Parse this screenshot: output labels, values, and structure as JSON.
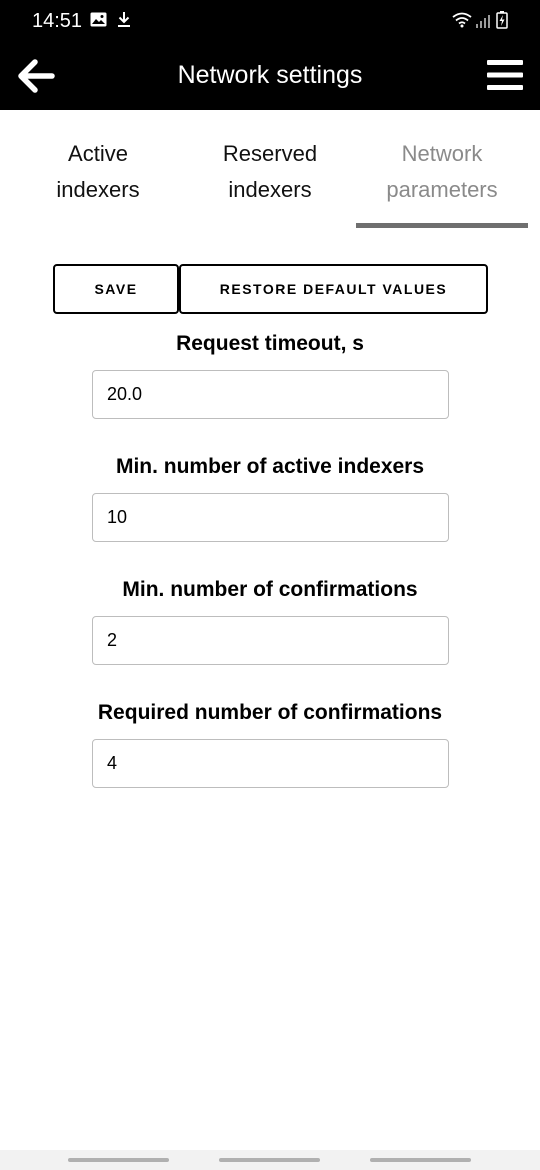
{
  "status_bar": {
    "time": "14:51",
    "icons": [
      "image-icon",
      "download-icon",
      "wifi-icon",
      "signal-icon",
      "battery-charging-icon"
    ]
  },
  "app_bar": {
    "title": "Network settings",
    "back_icon": "arrow-left-icon",
    "menu_icon": "hamburger-menu-icon"
  },
  "tabs": [
    {
      "line1": "Active",
      "line2": "indexers",
      "active": false
    },
    {
      "line1": "Reserved",
      "line2": "indexers",
      "active": false
    },
    {
      "line1": "Network",
      "line2": "parameters",
      "active": true
    }
  ],
  "actions": {
    "save_label": "SAVE",
    "restore_label": "RESTORE DEFAULT VALUES"
  },
  "fields": [
    {
      "label": "Request timeout, s",
      "value": "20.0"
    },
    {
      "label": "Min. number of active indexers",
      "value": "10"
    },
    {
      "label": "Min. number of confirmations",
      "value": "2"
    },
    {
      "label": "Required number of confirmations",
      "value": "4"
    }
  ],
  "colors": {
    "bar_background": "#000000",
    "active_tab_text": "#8a8a8a",
    "active_tab_indicator": "#6f6f6f",
    "input_border": "#bdbdbd"
  }
}
